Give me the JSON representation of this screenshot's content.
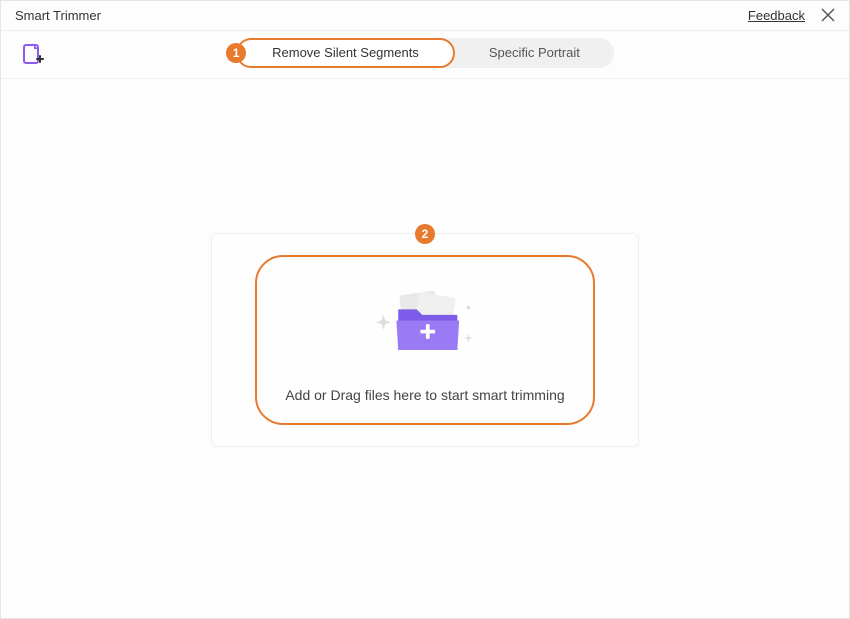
{
  "window": {
    "title": "Smart Trimmer",
    "feedback": "Feedback"
  },
  "tabs": {
    "remove_silent": "Remove Silent Segments",
    "specific_portrait": "Specific Portrait"
  },
  "steps": {
    "one": "1",
    "two": "2"
  },
  "dropzone": {
    "text": "Add or Drag files here to start smart trimming"
  }
}
